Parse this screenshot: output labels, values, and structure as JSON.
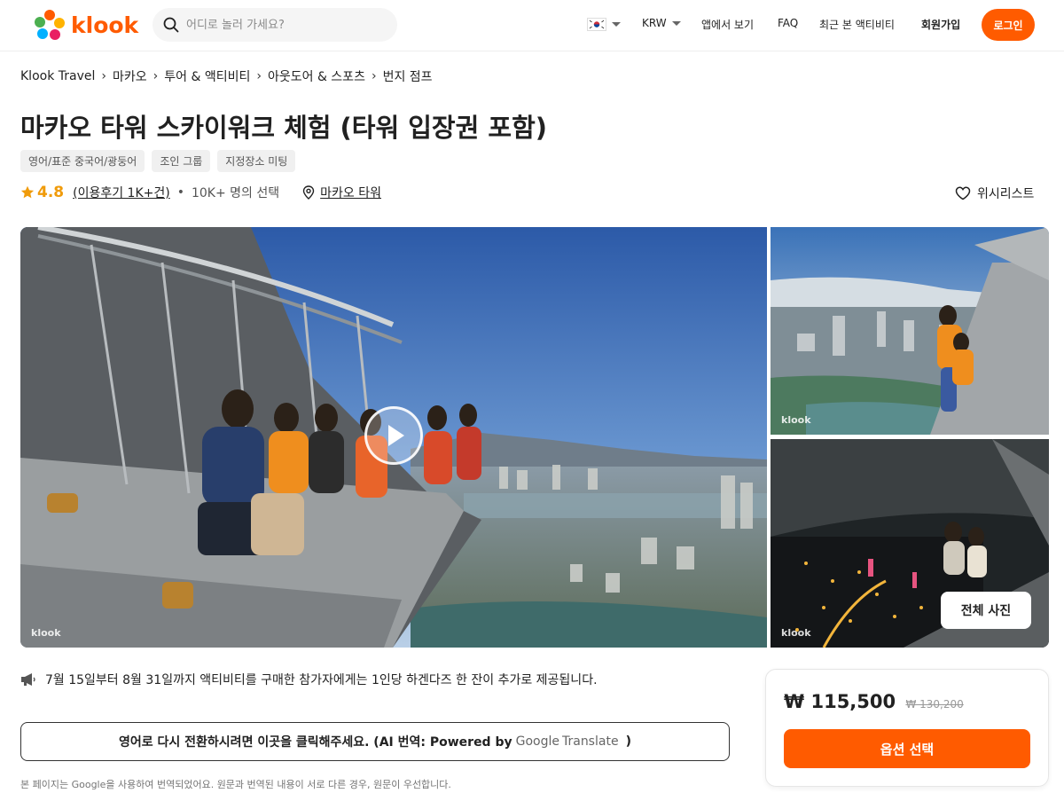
{
  "header": {
    "logo_text": "klook",
    "search_placeholder": "어디로 놀러 가세요?",
    "currency": "KRW",
    "app_view": "앱에서 보기",
    "faq": "FAQ",
    "recent": "최근 본 액티비티",
    "signup": "회원가입",
    "login": "로그인"
  },
  "breadcrumb": [
    "Klook Travel",
    "마카오",
    "투어 & 액티비티",
    "아웃도어 & 스포츠",
    "번지 점프"
  ],
  "title": "마카오 타워 스카이워크 체험 (타워 입장권 포함)",
  "tags": [
    "영어/표준 중국어/광둥어",
    "조인 그룹",
    "지정장소 미팅"
  ],
  "meta": {
    "rating": "4.8",
    "reviews": "(이용후기 1K+건)",
    "dot": "•",
    "booked": "10K+ 명의 선택",
    "location": "마카오 타워",
    "wishlist": "위시리스트"
  },
  "gallery": {
    "watermark": "klook",
    "all_photos": "전체 사진"
  },
  "notice": "7월 15일부터 8월 31일까지 액티비티를 구매한 참가자에게는 1인당 하겐다즈 한 잔이 추가로 제공됩니다.",
  "translate": {
    "text": "영어로 다시 전환하시려면 이곳을 클릭해주세요. (AI 번역: Powered by",
    "google": "Google",
    "translate": "Translate",
    "close_paren": ")"
  },
  "footnote": "본 페이지는 Google을 사용하여 번역되었어요. 원문과 번역된 내용이 서로 다른 경우, 원문이 우선합니다.",
  "price": {
    "current": "₩ 115,500",
    "original": "₩ 130,200",
    "button": "옵션 선택"
  },
  "colors": {
    "brand": "#ff5b00",
    "star": "#f09b0a"
  }
}
